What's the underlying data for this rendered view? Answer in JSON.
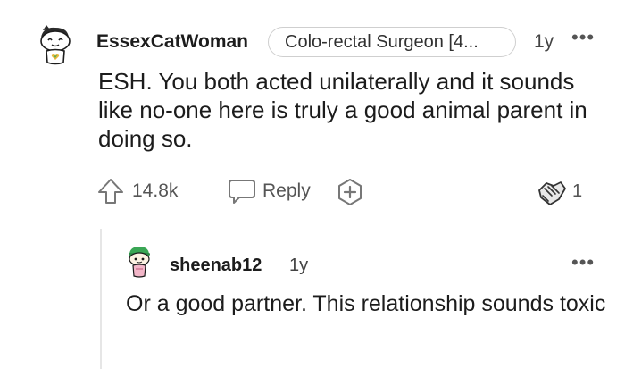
{
  "comment": {
    "username": "EssexCatWoman",
    "flair": "Colo-rectal Surgeon [4...",
    "age": "1y",
    "more": "•••",
    "body": "ESH. You both acted unilaterally and it sounds like no-one here is truly a good animal parent in doing so.",
    "upvote_count": "14.8k",
    "reply_label": "Reply",
    "award_count": "1"
  },
  "reply": {
    "username": "sheenab12",
    "age": "1y",
    "more": "•••",
    "body": "Or a good partner. This relationship sounds toxic"
  },
  "icons": {
    "upvote": "upvote-arrow-icon",
    "reply": "speech-bubble-icon",
    "award": "plus-award-icon",
    "given_award": "handshake-award-icon",
    "more": "more-dots-icon"
  },
  "colors": {
    "text": "#1c1c1c",
    "muted": "#555555",
    "border": "#cfcfcf",
    "avatar_green": "#3aa655"
  }
}
